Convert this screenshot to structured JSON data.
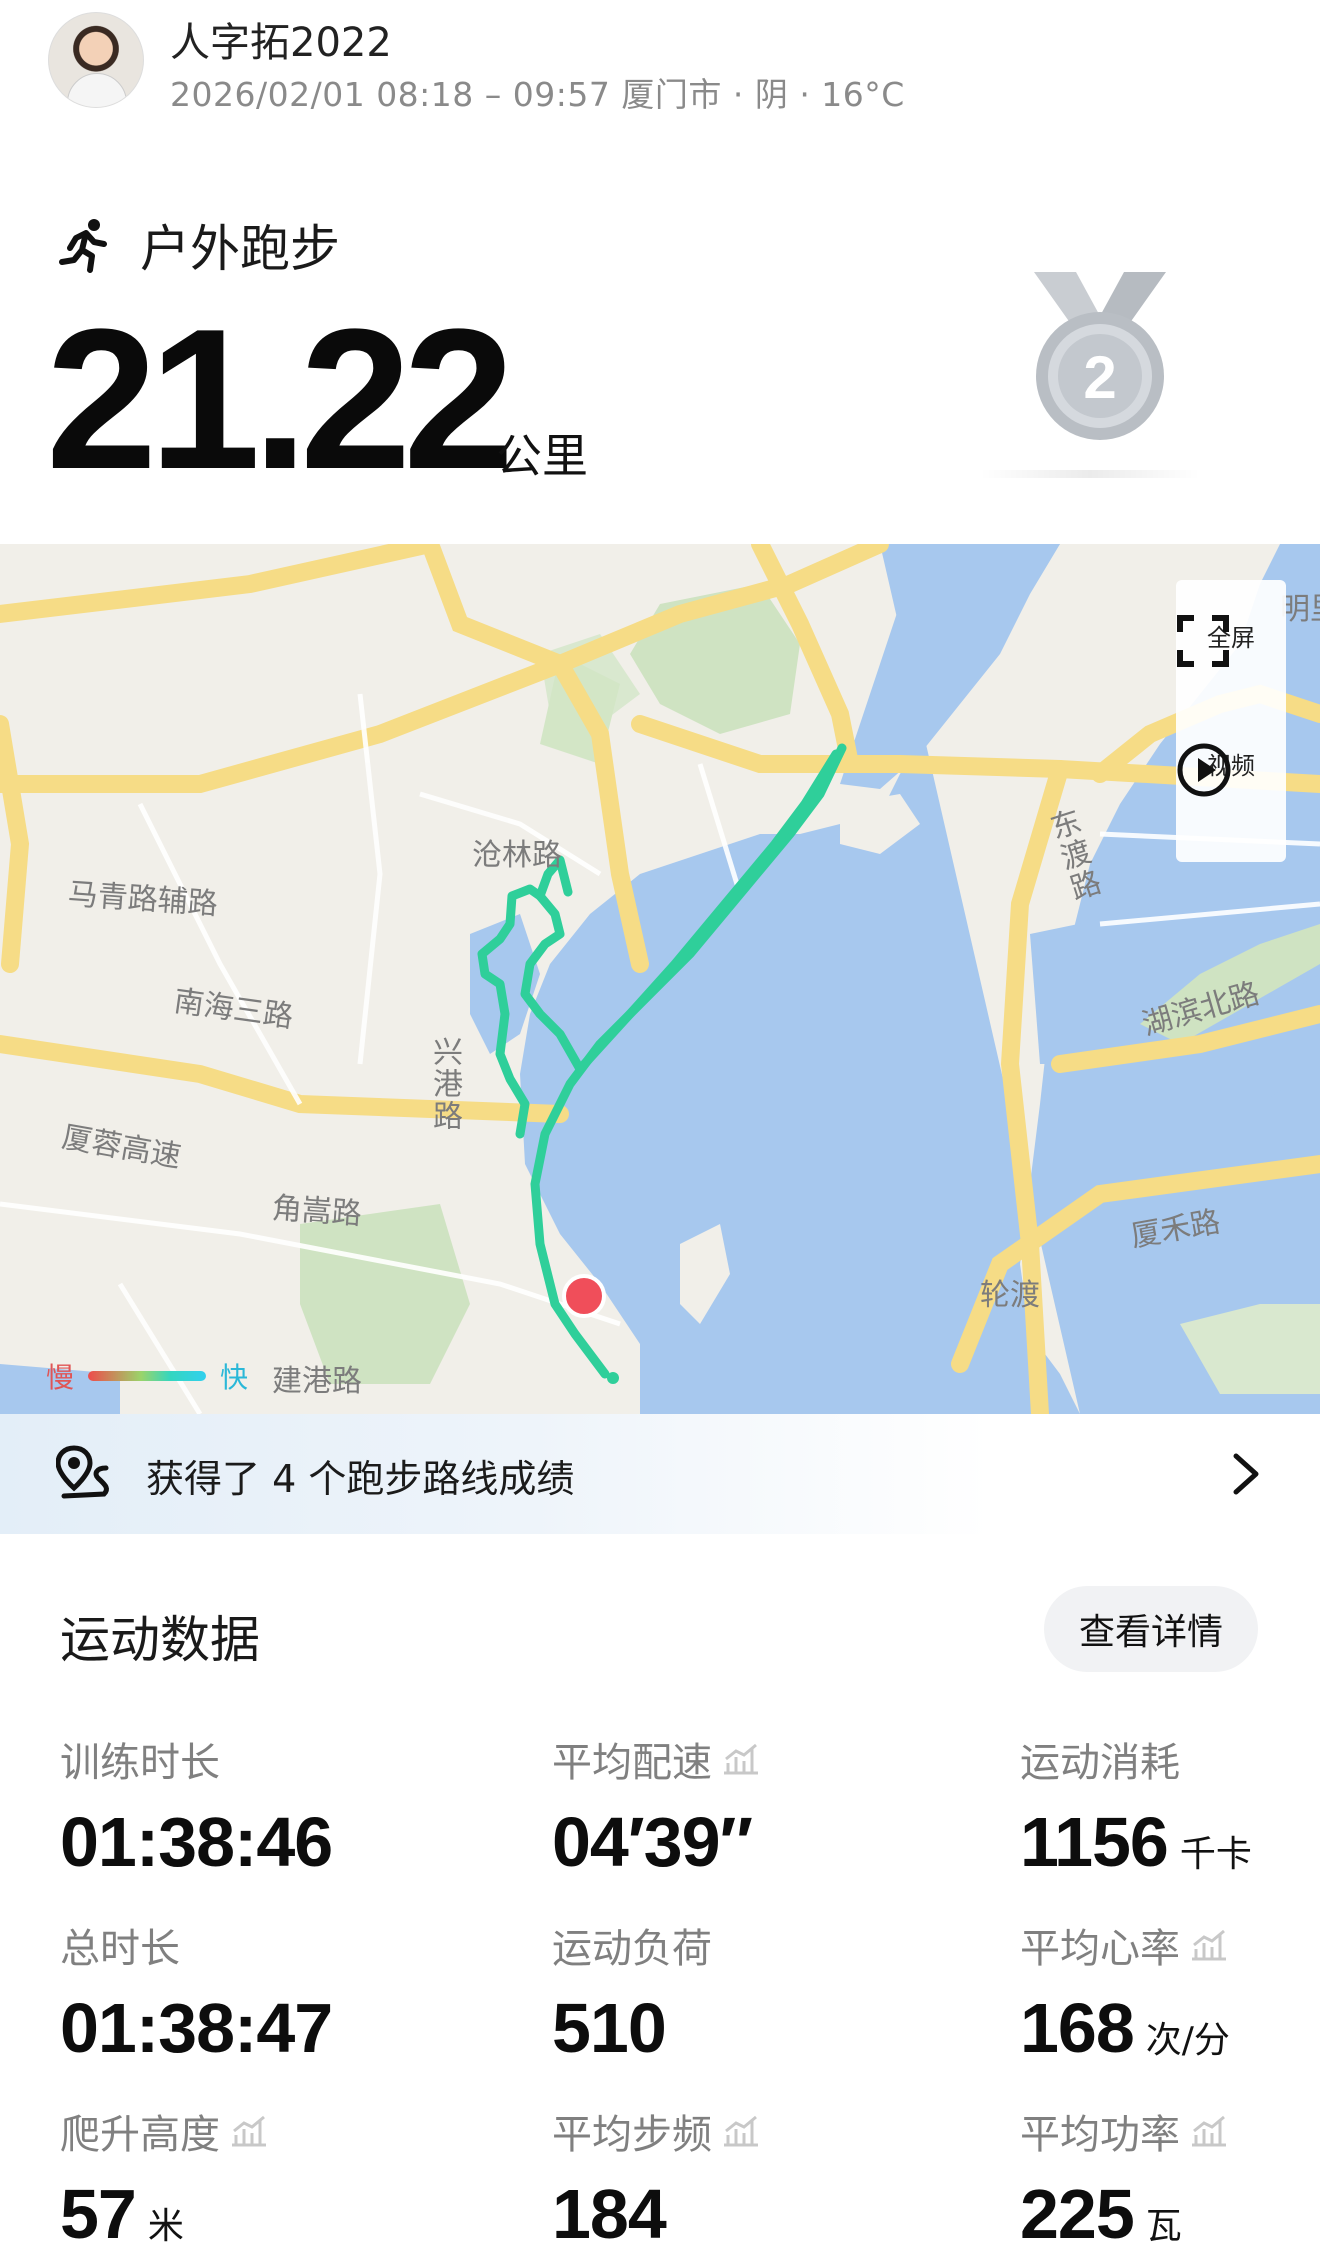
{
  "header": {
    "username": "人字拓2022",
    "meta": "2026/02/01 08:18 – 09:57 厦门市 · 阴 · 16°C"
  },
  "sport": {
    "title": "户外跑步",
    "distance": "21.22",
    "distance_unit": "公里",
    "medal_rank": "2"
  },
  "map": {
    "labels": {
      "canglin": "沧林路",
      "maqing": "马青路辅路",
      "nanhai": "南海三路",
      "xinggang": "兴港路",
      "xiarong": "厦蓉高速",
      "jiaosong": "角嵩路",
      "jiangang": "建港路",
      "dongdu": "东渡路",
      "hubin": "湖滨北路",
      "xiahe": "厦禾路",
      "lundu": "轮渡",
      "edge": "明里"
    },
    "controls": {
      "fullscreen": "全屏",
      "video": "视频"
    },
    "legend": {
      "slow": "慢",
      "fast": "快"
    },
    "colors": {
      "water": "#a7c8ee",
      "route": "#2fcf9a",
      "start": "#f04e5a"
    }
  },
  "route_banner": {
    "text": "获得了 4 个跑步路线成绩"
  },
  "stats": {
    "title": "运动数据",
    "detail_button": "查看详情",
    "items": [
      {
        "label": "训练时长",
        "value": "01:38:46",
        "unit": ""
      },
      {
        "label": "平均配速",
        "value": "04′39″",
        "unit": ""
      },
      {
        "label": "运动消耗",
        "value": "1156",
        "unit": "千卡"
      },
      {
        "label": "总时长",
        "value": "01:38:47",
        "unit": ""
      },
      {
        "label": "运动负荷",
        "value": "510",
        "unit": ""
      },
      {
        "label": "平均心率",
        "value": "168",
        "unit": "次/分"
      },
      {
        "label": "爬升高度",
        "value": "57",
        "unit": "米"
      },
      {
        "label": "平均步频",
        "value": "184",
        "unit": ""
      },
      {
        "label": "平均功率",
        "value": "225",
        "unit": "瓦"
      }
    ]
  }
}
